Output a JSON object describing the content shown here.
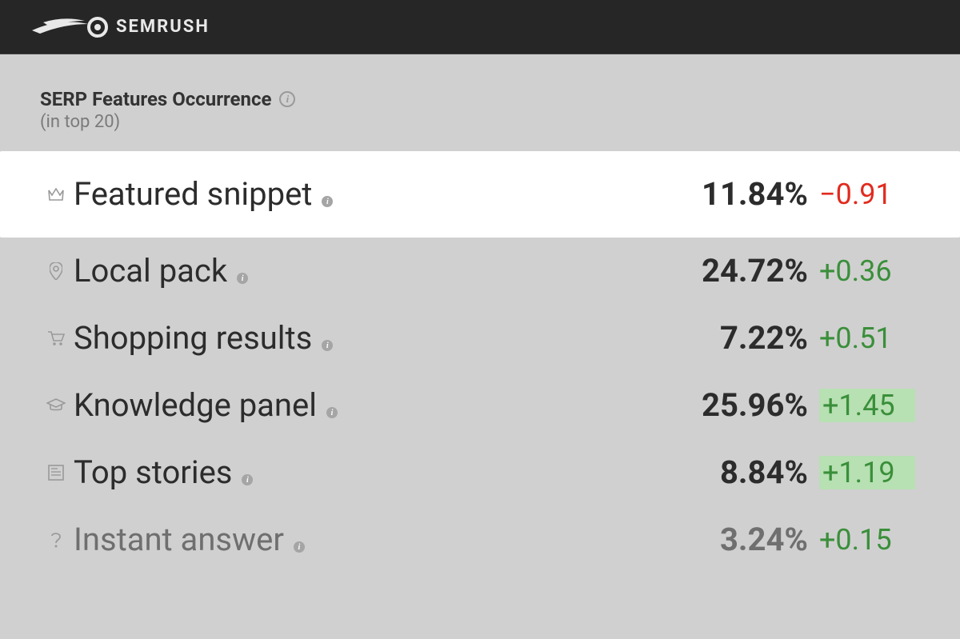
{
  "brand": {
    "name": "SEMRUSH"
  },
  "panel": {
    "title": "SERP Features Occurrence",
    "subtitle": "(in top 20)"
  },
  "features": [
    {
      "icon": "crown-icon",
      "label": "Featured snippet",
      "value": "11.84%",
      "delta": "−0.91",
      "delta_sign": "neg",
      "highlight": true,
      "delta_hl": false
    },
    {
      "icon": "pin-icon",
      "label": "Local pack",
      "value": "24.72%",
      "delta": "+0.36",
      "delta_sign": "pos",
      "highlight": false,
      "delta_hl": false
    },
    {
      "icon": "cart-icon",
      "label": "Shopping results",
      "value": "7.22%",
      "delta": "+0.51",
      "delta_sign": "pos",
      "highlight": false,
      "delta_hl": false
    },
    {
      "icon": "cap-icon",
      "label": "Knowledge panel",
      "value": "25.96%",
      "delta": "+1.45",
      "delta_sign": "pos",
      "highlight": false,
      "delta_hl": true
    },
    {
      "icon": "news-icon",
      "label": "Top stories",
      "value": "8.84%",
      "delta": "+1.19",
      "delta_sign": "pos",
      "highlight": false,
      "delta_hl": true
    },
    {
      "icon": "question-icon",
      "label": "Instant answer",
      "value": "3.24%",
      "delta": "+0.15",
      "delta_sign": "pos",
      "highlight": false,
      "delta_hl": false,
      "dim": true
    }
  ]
}
